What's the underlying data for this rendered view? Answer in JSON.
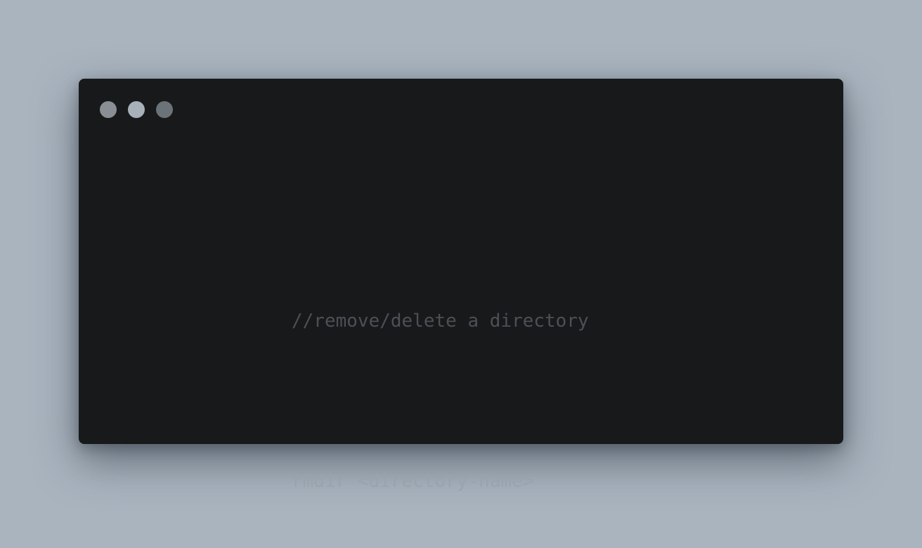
{
  "window": {
    "controls": [
      {
        "name": "close-dot-icon",
        "color": "#8a8f95"
      },
      {
        "name": "minimize-dot-icon",
        "color": "#a8b1ba"
      },
      {
        "name": "maximize-dot-icon",
        "color": "#6b7278"
      }
    ]
  },
  "code": {
    "comment": "//remove/delete a directory",
    "blank": "",
    "command": "rmdir <directory-name>"
  },
  "colors": {
    "background": "#a9b4bf",
    "window": "#18191b",
    "comment": "#4c5055",
    "command": "#9aa3ad"
  }
}
